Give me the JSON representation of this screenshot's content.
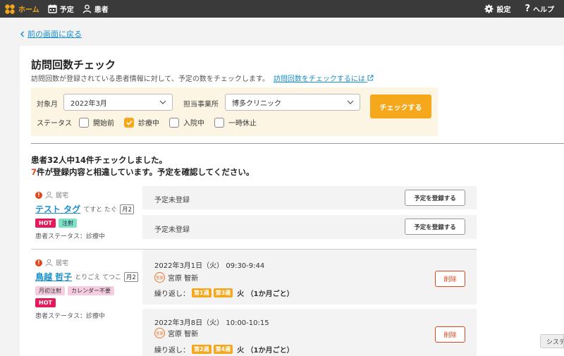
{
  "nav": {
    "home": "ホーム",
    "schedule": "予定",
    "patients": "患者",
    "settings": "設定",
    "help": "ヘルプ",
    "active_color": "#f2a51c"
  },
  "back_link": "前の画面に戻る",
  "page": {
    "title": "訪問回数チェック",
    "description": "訪問回数が登録されている患者情報に対して、予定の数をチェックします。",
    "help_link": "訪問回数をチェックするには"
  },
  "filter": {
    "month_label": "対象月",
    "month_value": "2022年3月",
    "office_label": "担当事業所",
    "office_value": "博多クリニック",
    "check_button": "チェックする",
    "status_label": "ステータス",
    "statuses": [
      {
        "label": "開始前",
        "checked": false
      },
      {
        "label": "診療中",
        "checked": true
      },
      {
        "label": "入院中",
        "checked": false
      },
      {
        "label": "一時休止",
        "checked": false
      }
    ]
  },
  "summary": {
    "line1": "患者32人中14件チェックしました。",
    "mismatch_count": "7",
    "line2_suffix": "件が登録内容と相違しています。予定を確認してください。"
  },
  "patients": [
    {
      "residence": "居宅",
      "name": "テスト タグ",
      "kana": "てすと たぐ",
      "monthly": "月2",
      "tags": [
        {
          "label": "HOT",
          "type": "hot"
        },
        {
          "label": "注射",
          "type": "green"
        }
      ],
      "status": "患者ステータス：診療中",
      "slots": [
        {
          "text": "予定未登録",
          "button": "予定を登録する"
        },
        {
          "text": "予定未登録",
          "button": "予定を登録する"
        }
      ]
    },
    {
      "residence": "居宅",
      "name": "鳥越 哲子",
      "kana": "とりごえ てつこ",
      "monthly": "月2",
      "tags": [
        {
          "label": "月初注射",
          "type": "pink"
        },
        {
          "label": "カレンダー不要",
          "type": "pink"
        },
        {
          "label": "HOT",
          "type": "hot"
        }
      ],
      "status": "患者ステータス：診療中",
      "visits": [
        {
          "date": "2022年3月1日（火） 09:30-9:44",
          "staff_badge": "宮原",
          "staff": "宮原 智新",
          "repeat_label": "繰り返し：",
          "weeks": [
            "第1週",
            "第3週"
          ],
          "freq": "火 （1か月ごと）",
          "button": "削除"
        },
        {
          "date": "2022年3月8日（火） 10:00-10:15",
          "staff_badge": "宮原",
          "staff": "宮原 智新",
          "repeat_label": "繰り返し：",
          "weeks": [
            "第2週",
            "第4週"
          ],
          "freq": "火 （1か月ごと）",
          "button": "削除"
        }
      ]
    }
  ],
  "corner_tab": "システ"
}
